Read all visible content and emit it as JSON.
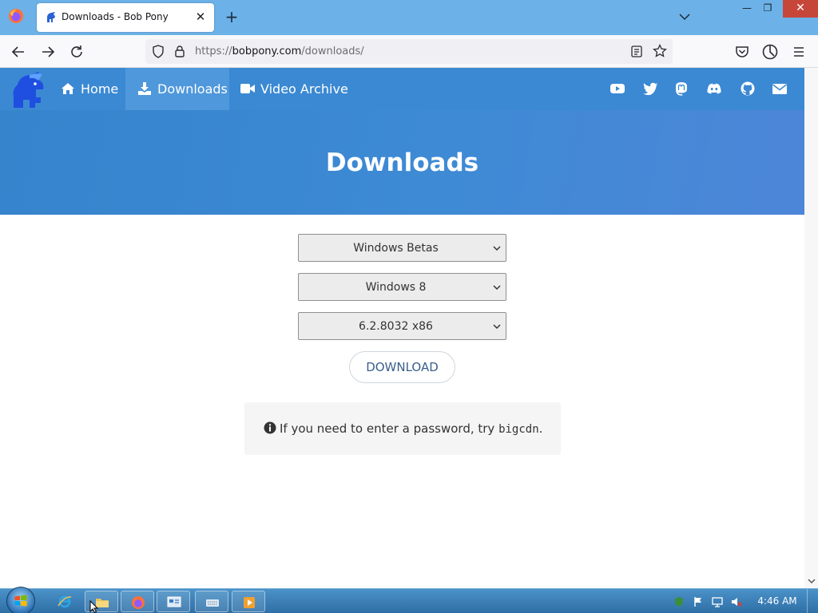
{
  "browser": {
    "tab": {
      "title": "Downloads - Bob Pony",
      "close": "✕"
    },
    "new_tab": "+",
    "window_controls": {
      "minimize": "—",
      "maximize": "❐",
      "close": "✕"
    },
    "url": {
      "scheme": "https://",
      "host": "bobpony.com",
      "path": "/downloads/"
    }
  },
  "site": {
    "nav": [
      {
        "label": "Home",
        "icon": "home-icon"
      },
      {
        "label": "Downloads",
        "icon": "download-icon",
        "active": true
      },
      {
        "label": "Video Archive",
        "icon": "video-camera-icon"
      }
    ],
    "social_icons": [
      "youtube-icon",
      "twitter-icon",
      "mastodon-icon",
      "discord-icon",
      "github-icon",
      "mail-icon"
    ],
    "hero_title": "Downloads",
    "selects": {
      "category": "Windows Betas",
      "os": "Windows 8",
      "build": "6.2.8032 x86"
    },
    "download_button": "DOWNLOAD",
    "note": {
      "text": "If you need to enter a password, try ",
      "password": "bigcdn",
      "end": "."
    }
  },
  "taskbar": {
    "clock": "4:46 AM",
    "pinned": [
      "internet-explorer-icon",
      "folder-icon",
      "firefox-icon",
      "control-panel-icon",
      "keyboard-icon",
      "media-player-icon"
    ]
  },
  "colors": {
    "site_nav": "#3b89d3",
    "hero": "#3e8ad5",
    "tabstrip": "#6cb2e8"
  }
}
